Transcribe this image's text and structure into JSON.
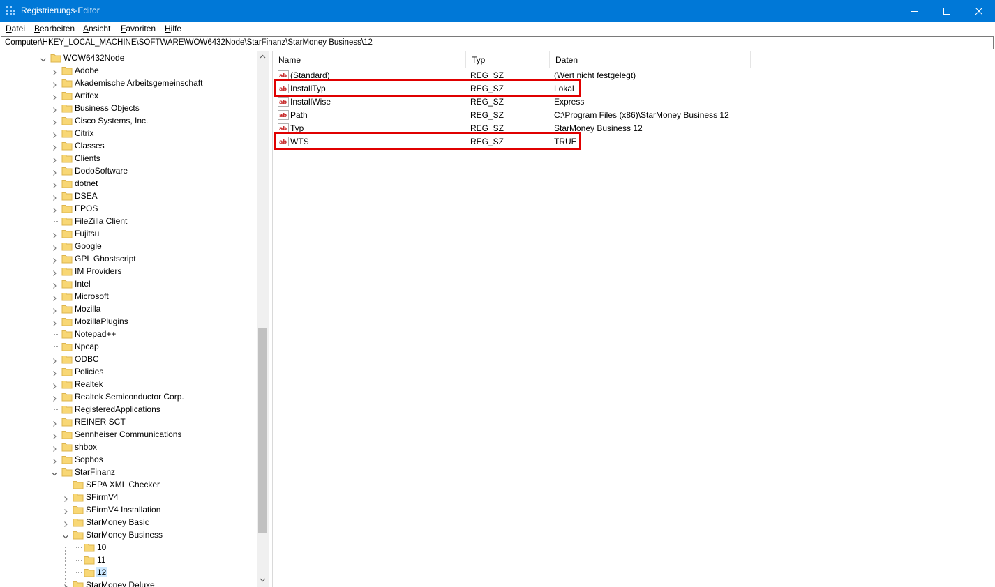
{
  "window": {
    "title": "Registrierungs-Editor",
    "controls": {
      "minimize": "minimize",
      "maximize": "maximize",
      "close": "close"
    }
  },
  "menu": [
    {
      "accel": "D",
      "rest": "atei"
    },
    {
      "accel": "B",
      "rest": "earbeiten"
    },
    {
      "accel": "A",
      "rest": "nsicht"
    },
    {
      "accel": "F",
      "rest": "avoriten"
    },
    {
      "accel": "H",
      "rest": "ilfe"
    }
  ],
  "address": {
    "path": "Computer\\HKEY_LOCAL_MACHINE\\SOFTWARE\\WOW6432Node\\StarFinanz\\StarMoney Business\\12"
  },
  "tree": {
    "root": "WOW6432Node",
    "level1": [
      "Adobe",
      "Akademische Arbeitsgemeinschaft",
      "Artifex",
      "Business Objects",
      "Cisco Systems, Inc.",
      "Citrix",
      "Classes",
      "Clients",
      "DodoSoftware",
      "dotnet",
      "DSEA",
      "EPOS",
      "FileZilla Client",
      "Fujitsu",
      "Google",
      "GPL Ghostscript",
      "IM Providers",
      "Intel",
      "Microsoft",
      "Mozilla",
      "MozillaPlugins",
      "Notepad++",
      "Npcap",
      "ODBC",
      "Policies",
      "Realtek",
      "Realtek Semiconductor Corp.",
      "RegisteredApplications",
      "REINER SCT",
      "Sennheiser Communications",
      "shbox",
      "Sophos",
      "StarFinanz"
    ],
    "level1_leaf": [
      "FileZilla Client",
      "Notepad++",
      "Npcap",
      "RegisteredApplications"
    ],
    "starfinanz_children": [
      "SEPA XML Checker",
      "SFirmV4",
      "SFirmV4 Installation",
      "StarMoney Basic",
      "StarMoney Business",
      "StarMoney Deluxe"
    ],
    "business_children": [
      "10",
      "11",
      "12"
    ],
    "selected": "12"
  },
  "list": {
    "headers": {
      "name": "Name",
      "type": "Typ",
      "data": "Daten"
    },
    "rows": [
      {
        "name": "(Standard)",
        "type": "REG_SZ",
        "data": "(Wert nicht festgelegt)",
        "highlighted": false
      },
      {
        "name": "InstallTyp",
        "type": "REG_SZ",
        "data": "Lokal",
        "highlighted": true
      },
      {
        "name": "InstallWise",
        "type": "REG_SZ",
        "data": "Express",
        "highlighted": false
      },
      {
        "name": "Path",
        "type": "REG_SZ",
        "data": "C:\\Program Files (x86)\\StarMoney Business 12",
        "highlighted": false
      },
      {
        "name": "Typ",
        "type": "REG_SZ",
        "data": "StarMoney Business 12",
        "highlighted": false
      },
      {
        "name": "WTS",
        "type": "REG_SZ",
        "data": "TRUE",
        "highlighted": true
      }
    ],
    "value_icon": "string-value-icon"
  },
  "colors": {
    "titlebar": "#0078d7",
    "highlight_box": "#e00000",
    "selection": "#cce8ff",
    "folder": "#f8d775"
  }
}
